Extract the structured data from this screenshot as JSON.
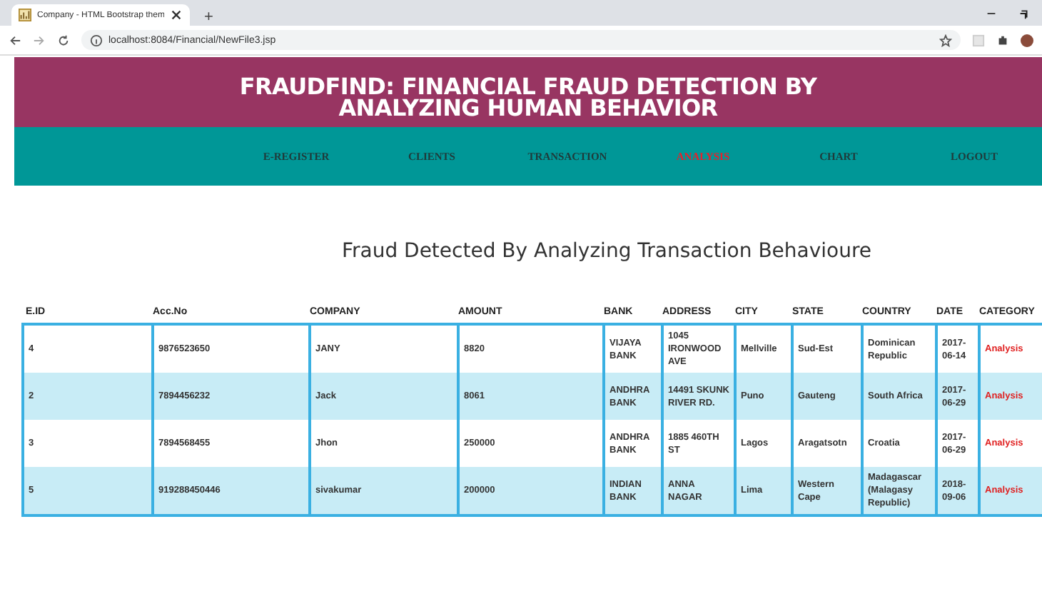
{
  "browser": {
    "tab_title": "Company - HTML Bootstrap them",
    "new_tab": "+",
    "url": "localhost:8084/Financial/NewFile3.jsp"
  },
  "header": {
    "title": "FRAUDFIND: FINANCIAL FRAUD DETECTION BY ANALYZING HUMAN BEHAVIOR"
  },
  "nav": [
    {
      "label": "E-REGISTER",
      "selected": false
    },
    {
      "label": "CLIENTS",
      "selected": false
    },
    {
      "label": "TRANSACTION",
      "selected": false
    },
    {
      "label": "ANALYSIS",
      "selected": true
    },
    {
      "label": "CHART",
      "selected": false
    },
    {
      "label": "LOGOUT",
      "selected": false
    }
  ],
  "heading": "Fraud Detected By Analyzing Transaction Behavioure",
  "table": {
    "columns": [
      {
        "label": "E.ID",
        "kind": "text"
      },
      {
        "label": "Acc.No",
        "kind": "text"
      },
      {
        "label": "COMPANY",
        "kind": "text"
      },
      {
        "label": "AMOUNT",
        "kind": "text"
      },
      {
        "label": "BANK",
        "kind": "text"
      },
      {
        "label": "ADDRESS",
        "kind": "text"
      },
      {
        "label": "CITY",
        "kind": "text"
      },
      {
        "label": "STATE",
        "kind": "text"
      },
      {
        "label": "COUNTRY",
        "kind": "text"
      },
      {
        "label": "DATE",
        "kind": "text"
      },
      {
        "label": "CATEGORY",
        "kind": "link"
      }
    ],
    "rows": [
      [
        "4",
        "9876523650",
        "JANY",
        "8820",
        "VIJAYA BANK",
        "1045 IRONWOOD AVE",
        "Mellville",
        "Sud-Est",
        "Dominican Republic",
        "2017-06-14",
        "Analysis"
      ],
      [
        "2",
        "7894456232",
        "Jack",
        "8061",
        "ANDHRA BANK",
        "14491 SKUNK RIVER RD.",
        "Puno",
        "Gauteng",
        "South Africa",
        "2017-06-29",
        "Analysis"
      ],
      [
        "3",
        "7894568455",
        "Jhon",
        "250000",
        "ANDHRA BANK",
        "1885 460TH ST",
        "Lagos",
        "Aragatsotn",
        "Croatia",
        "2017-06-29",
        "Analysis"
      ],
      [
        "5",
        "919288450446",
        "sivakumar",
        "200000",
        "INDIAN BANK",
        "ANNA NAGAR",
        "Lima",
        "Western Cape",
        "Madagascar (Malagasy Republic)",
        "2018-09-06",
        "Analysis"
      ]
    ]
  }
}
